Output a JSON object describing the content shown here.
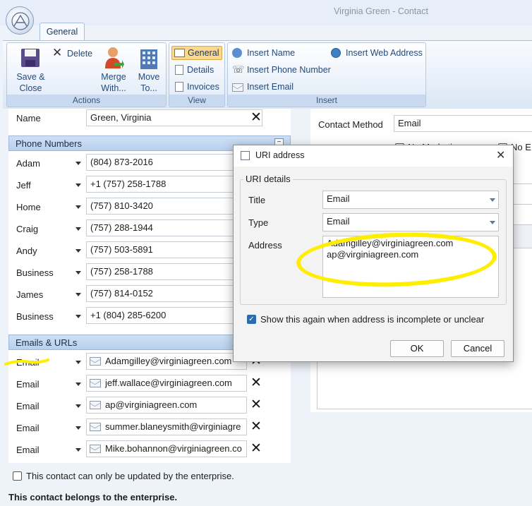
{
  "window": {
    "title": "Virginia Green - Contact"
  },
  "ribbon": {
    "tab": "General",
    "actions": {
      "title": "Actions",
      "save_close": [
        "Save &",
        "Close"
      ],
      "delete": "Delete",
      "merge_with": [
        "Merge",
        "With..."
      ],
      "move_to": [
        "Move",
        "To..."
      ]
    },
    "view": {
      "title": "View",
      "general": "General",
      "details": "Details",
      "invoices": "Invoices"
    },
    "insert": {
      "title": "Insert",
      "insert_name": "Insert Name",
      "insert_phone": "Insert Phone Number",
      "insert_email": "Insert Email",
      "insert_web": "Insert Web Address"
    }
  },
  "name_row": {
    "label": "Name",
    "value": "Green, Virginia"
  },
  "phone_numbers": {
    "title": "Phone Numbers",
    "rows": [
      {
        "label": "Adam",
        "value": "(804) 873-2016"
      },
      {
        "label": "Jeff",
        "value": "+1 (757) 258-1788"
      },
      {
        "label": "Home",
        "value": "(757) 810-3420"
      },
      {
        "label": "Craig",
        "value": "(757) 288-1944"
      },
      {
        "label": "Andy",
        "value": "(757) 503-5891"
      },
      {
        "label": "Business",
        "value": "(757) 258-1788"
      },
      {
        "label": "James",
        "value": "(757) 814-0152"
      },
      {
        "label": "Business",
        "value": "+1 (804) 285-6200"
      }
    ]
  },
  "emails_urls": {
    "title": "Emails & URLs",
    "rows": [
      {
        "label": "Email",
        "value": "Adamgilley@virginiagreen.com"
      },
      {
        "label": "Email",
        "value": "jeff.wallace@virginiagreen.com"
      },
      {
        "label": "Email",
        "value": "ap@virginiagreen.com"
      },
      {
        "label": "Email",
        "value": "summer.blaneysmith@virginiagre"
      },
      {
        "label": "Email",
        "value": "Mike.bohannon@virginiagreen.co"
      }
    ]
  },
  "enterprise_checkbox": "This contact can only be updated by the enterprise.",
  "enterprise_note": "This contact belongs to the enterprise.",
  "right_pane": {
    "contact_method_label": "Contact Method",
    "contact_method_value": "Email",
    "check1": "No Marketing",
    "check2": "No E"
  },
  "dialog": {
    "title": "URI address",
    "group": "URI details",
    "title_label": "Title",
    "title_value": "Email",
    "type_label": "Type",
    "type_value": "Email",
    "address_label": "Address",
    "address_line1": "Adamgilley@virginiagreen.com",
    "address_line2": "ap@virginiagreen.com",
    "show_again": "Show this again when address is incomplete or unclear",
    "ok": "OK",
    "cancel": "Cancel"
  },
  "colors": {
    "highlight": "#ffee00",
    "ribbon_text": "#254a78",
    "checkbox_accent": "#2b6cb0"
  }
}
